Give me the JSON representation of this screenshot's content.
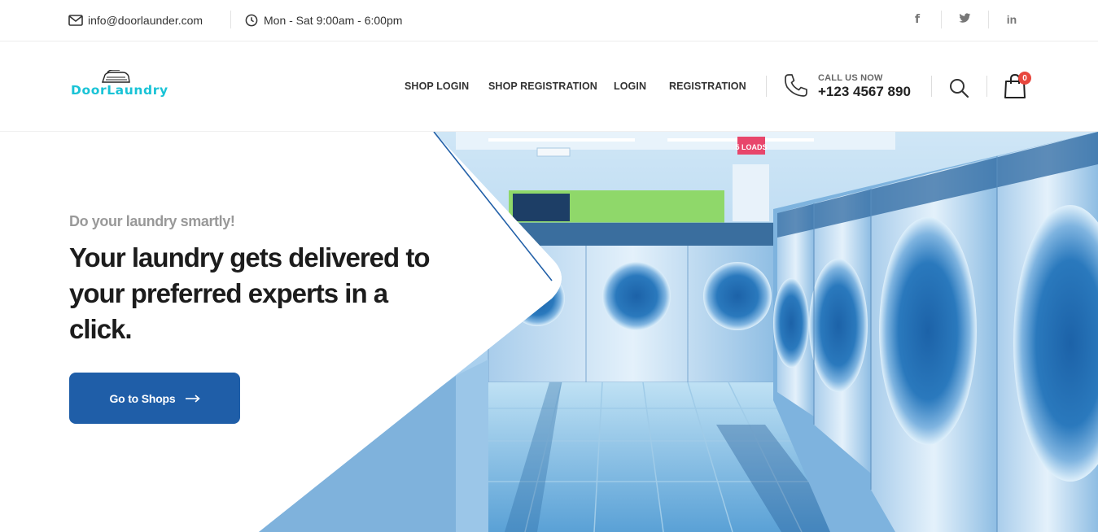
{
  "topbar": {
    "email": "info@doorlaunder.com",
    "hours": "Mon - Sat 9:00am - 6:00pm",
    "social": [
      {
        "name": "facebook",
        "glyph": "f"
      },
      {
        "name": "twitter",
        "glyph": "t"
      },
      {
        "name": "linkedin",
        "glyph": "in"
      }
    ]
  },
  "header": {
    "logo_text": "DoorLaundry",
    "nav": [
      "SHOP LOGIN",
      "SHOP REGISTRATION",
      "LOGIN",
      "REGISTRATION"
    ],
    "call_label": "CALL US NOW",
    "call_number": "+123 4567 890",
    "cart_count": "0"
  },
  "hero": {
    "tagline": "Do your laundry smartly!",
    "headline": "Your laundry gets delivered to your preferred experts in a click.",
    "cta_label": "Go to Shops",
    "sign_text": "5 LOADS"
  },
  "colors": {
    "brand": "#19c3d6",
    "button": "#1f5ea8",
    "badge": "#e8473e"
  }
}
